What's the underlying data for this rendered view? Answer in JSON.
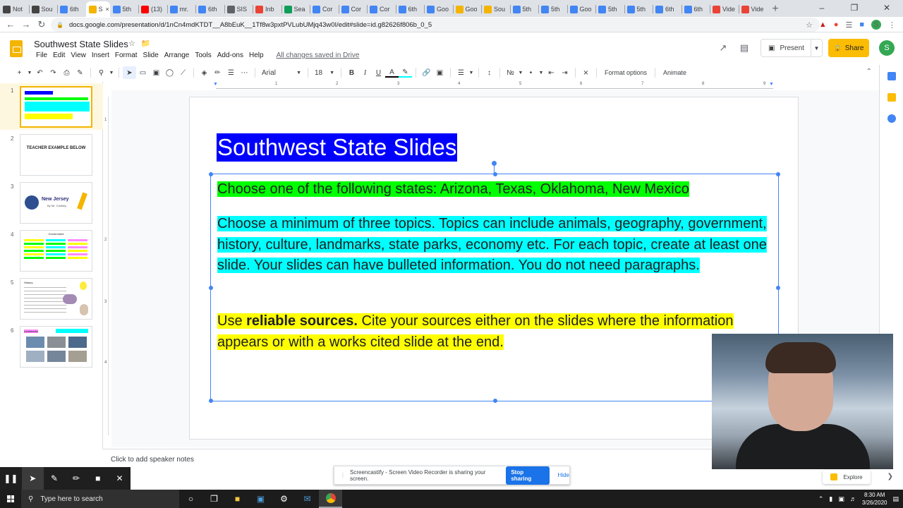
{
  "browser": {
    "tabs": [
      {
        "label": "Not",
        "icon": "wikipedia-icon",
        "color": "#444444"
      },
      {
        "label": "Sou",
        "icon": "s-icon",
        "color": "#444444"
      },
      {
        "label": "6th",
        "icon": "docs-icon",
        "color": "#4285f4"
      },
      {
        "label": "S",
        "icon": "slides-icon",
        "color": "#f4b400",
        "active": true
      },
      {
        "label": "5th",
        "icon": "docs-icon",
        "color": "#4285f4"
      },
      {
        "label": "(13)",
        "icon": "youtube-icon",
        "color": "#ff0000"
      },
      {
        "label": "mr.",
        "icon": "docs-icon",
        "color": "#4285f4"
      },
      {
        "label": "6th",
        "icon": "docs-icon",
        "color": "#4285f4"
      },
      {
        "label": "SIS",
        "icon": "sis-icon",
        "color": "#5f6368"
      },
      {
        "label": "Inb",
        "icon": "gmail-icon",
        "color": "#ea4335"
      },
      {
        "label": "Sea",
        "icon": "drive-icon",
        "color": "#0f9d58"
      },
      {
        "label": "Cor",
        "icon": "docs-icon",
        "color": "#4285f4"
      },
      {
        "label": "Cor",
        "icon": "docs-icon",
        "color": "#4285f4"
      },
      {
        "label": "Cor",
        "icon": "docs-icon",
        "color": "#4285f4"
      },
      {
        "label": "6th",
        "icon": "docs-icon",
        "color": "#4285f4"
      },
      {
        "label": "Goo",
        "icon": "docs-icon",
        "color": "#4285f4"
      },
      {
        "label": "Goo",
        "icon": "slides-icon",
        "color": "#f4b400"
      },
      {
        "label": "Sou",
        "icon": "slides-icon",
        "color": "#f4b400"
      },
      {
        "label": "5th",
        "icon": "docs-icon",
        "color": "#4285f4"
      },
      {
        "label": "5th",
        "icon": "docs-icon",
        "color": "#4285f4"
      },
      {
        "label": "Goo",
        "icon": "docs-icon",
        "color": "#4285f4"
      },
      {
        "label": "5th",
        "icon": "docs-icon",
        "color": "#4285f4"
      },
      {
        "label": "5th",
        "icon": "docs-icon",
        "color": "#4285f4"
      },
      {
        "label": "6th",
        "icon": "docs-icon",
        "color": "#4285f4"
      },
      {
        "label": "6th",
        "icon": "docs-icon",
        "color": "#4285f4"
      },
      {
        "label": "Vide",
        "icon": "video-icon",
        "color": "#ea4335"
      },
      {
        "label": "Vide",
        "icon": "video-icon",
        "color": "#ea4335"
      }
    ],
    "url": "docs.google.com/presentation/d/1nCn4mdKTDT__A8bEuK__1Tf8w3pxtPVLubUMjq43w0I/edit#slide=id.g82626f806b_0_5",
    "profile_initial": "S"
  },
  "app": {
    "title": "Southwest State Slides",
    "menu": [
      "File",
      "Edit",
      "View",
      "Insert",
      "Format",
      "Slide",
      "Arrange",
      "Tools",
      "Add-ons",
      "Help"
    ],
    "saved_status": "All changes saved in Drive",
    "present_label": "Present",
    "share_label": "Share",
    "avatar_initial": "S"
  },
  "toolbar": {
    "font": "Arial",
    "size": "18",
    "format_options": "Format options",
    "animate": "Animate"
  },
  "ruler": {
    "h_numbers": [
      "1",
      "2",
      "3",
      "4",
      "5",
      "6",
      "7",
      "8",
      "9"
    ],
    "v_numbers": [
      "1",
      "2",
      "3",
      "4"
    ]
  },
  "filmstrip": [
    {
      "num": "1"
    },
    {
      "num": "2",
      "label": "TEACHER EXAMPLE BELOW"
    },
    {
      "num": "3",
      "label": "New Jersey",
      "sub": "By Mr. Cobbley"
    },
    {
      "num": "4",
      "label": "Government"
    },
    {
      "num": "5",
      "label": "History"
    },
    {
      "num": "6",
      "label": "Landmarks"
    }
  ],
  "slide": {
    "title": "Southwest State Slides",
    "p1": "Choose one of the following states: Arizona, Texas, Oklahoma, New Mexico",
    "p2": "Choose a minimum of three topics. Topics can include animals, geography, government, history, culture, landmarks, state parks, economy etc. For each topic, create at least one slide. Your slides can have bulleted information. You do not need paragraphs.",
    "p3_pre": "Use ",
    "p3_bold": "reliable sources.",
    "p3_post": " Cite your sources either on the slides where the information appears or with a works cited slide at the end."
  },
  "speaker_notes": "Click to add speaker notes",
  "screencastify": {
    "banner_text": "Screencastify - Screen Video Recorder is sharing your screen.",
    "stop_label": "Stop sharing",
    "hide_label": "Hide"
  },
  "explore_label": "Explore",
  "taskbar": {
    "search_placeholder": "Type here to search",
    "time": "8:30 AM",
    "date": "3/26/2020"
  },
  "colors": {
    "title_highlight": "#0000ff",
    "green_highlight": "#00ff00",
    "cyan_highlight": "#00ffff",
    "yellow_highlight": "#ffff00",
    "accent": "#4285f4",
    "share_button": "#fbbc04"
  }
}
